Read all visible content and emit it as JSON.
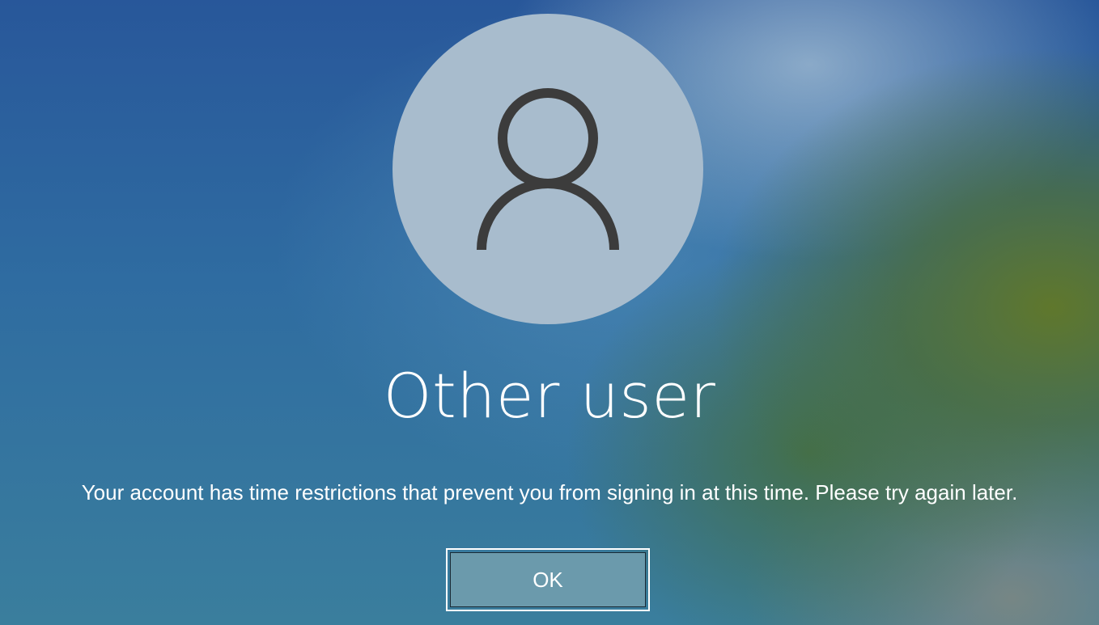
{
  "lockscreen": {
    "avatar_icon": "user-silhouette-icon",
    "username": "Other user",
    "message": "Your account has time restrictions that prevent you from signing in at this time. Please try again later.",
    "ok_label": "OK"
  },
  "colors": {
    "avatar_circle": "#a8bccd",
    "icon_stroke": "#3c3c3c",
    "button_fill": "#6b9aac",
    "text": "#ffffff"
  }
}
